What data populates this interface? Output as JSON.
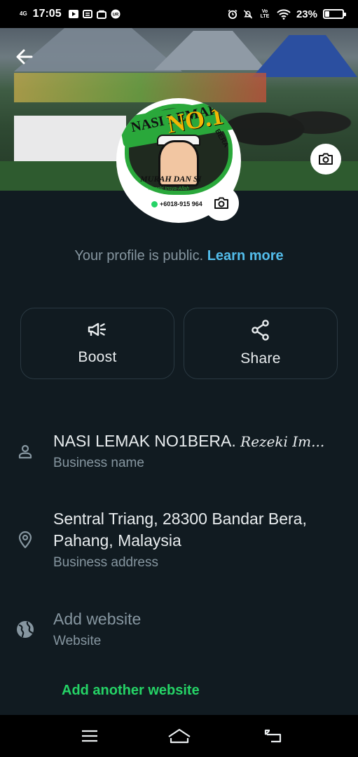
{
  "status_bar": {
    "network": "4G",
    "time": "17:05",
    "volte": "Vo LTE",
    "battery_percent": "23%",
    "battery_level": 0.23,
    "left_icons": [
      "play-icon",
      "mail-icon",
      "bag-icon",
      "camera-notification-icon"
    ],
    "right_icons": [
      "alarm-icon",
      "mute-icon",
      "volte-icon",
      "wifi-icon"
    ]
  },
  "header": {
    "back_icon": "arrow-left-icon",
    "cover_camera_icon": "camera-icon",
    "profile_camera_icon": "camera-icon"
  },
  "avatar": {
    "title": "NASI LEMAK",
    "badge": "NO.1",
    "location": "BERA",
    "motto": "MURAH DAN SI",
    "tagline": "Rezeki Insya-Allah",
    "phone": "+6018-915 964"
  },
  "profile": {
    "public_text": "Your profile is public.",
    "learn_more": "Learn more"
  },
  "actions": [
    {
      "label": "Boost",
      "icon": "megaphone-icon"
    },
    {
      "label": "Share",
      "icon": "share-icon"
    }
  ],
  "info": {
    "name": {
      "value": "NASI LEMAK NO1BERA.",
      "value_script": "Rezeki Im...",
      "caption": "Business name",
      "icon": "person-icon"
    },
    "address": {
      "value": "Sentral Triang, 28300 Bandar Bera, Pahang, Malaysia",
      "caption": "Business address",
      "icon": "location-pin-icon"
    },
    "website": {
      "value": "Add website",
      "caption": "Website",
      "icon": "globe-icon"
    }
  },
  "add_another_website": "Add another website",
  "nav": {
    "menu_icon": "menu-icon",
    "home_icon": "home-icon",
    "back_icon": "back-icon"
  },
  "colors": {
    "background": "#111B21",
    "accent_green": "#25D366",
    "link_blue": "#53BDEB",
    "secondary_text": "#8696A0"
  }
}
